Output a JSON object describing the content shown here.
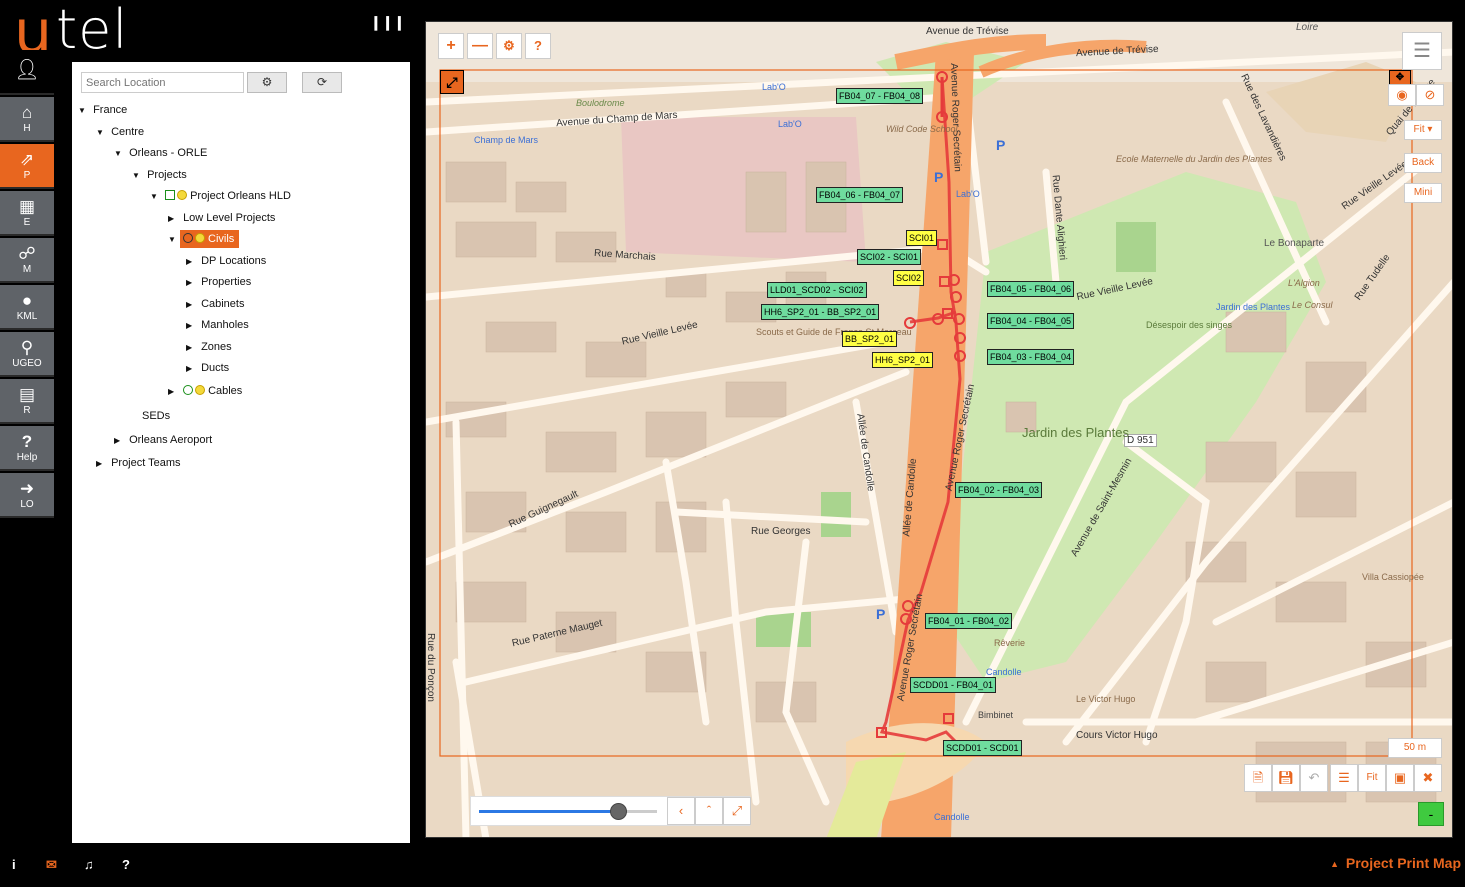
{
  "brand": {
    "logo_u": "u",
    "logo_tel": "tel"
  },
  "header": {
    "collapse_icon": "columns-icon"
  },
  "nav": {
    "items": [
      {
        "label": "",
        "icon": "user-icon"
      },
      {
        "label": "H",
        "icon": "home-icon"
      },
      {
        "label": "P",
        "icon": "share-icon"
      },
      {
        "label": "E",
        "icon": "chip-icon"
      },
      {
        "label": "M",
        "icon": "globe-icon"
      },
      {
        "label": "KML",
        "icon": "pin-icon"
      },
      {
        "label": "UGEO",
        "icon": "pin-icon"
      },
      {
        "label": "R",
        "icon": "card-icon"
      },
      {
        "label": "Help",
        "icon": "question-icon"
      },
      {
        "label": "LO",
        "icon": "logout-icon"
      }
    ]
  },
  "search": {
    "placeholder": "Search Location"
  },
  "tree": {
    "france": "France",
    "centre": "Centre",
    "orleans": "Orleans - ORLE",
    "projects": "Projects",
    "project_hld": "Project Orleans HLD",
    "low_level": "Low Level Projects",
    "civils": "Civils",
    "dp_locations": "DP Locations",
    "properties": "Properties",
    "cabinets": "Cabinets",
    "manholes": "Manholes",
    "zones": "Zones",
    "ducts": "Ducts",
    "cables": "Cables",
    "seds": "SEDs",
    "aeroport": "Orleans Aeroport",
    "teams": "Project Teams"
  },
  "map": {
    "streets": {
      "treviseA": "Avenue de Trévise",
      "treviseB": "Avenue de Trévise",
      "loire": "Loire",
      "champ": "Avenue du Champ de Mars",
      "boulodrome": "Boulodrome",
      "marchais": "Rue Marchais",
      "vieille1": "Rue Vieille Levée",
      "vieille2": "Rue Vieille Levée",
      "vieille3": "Rue Vieille Levée",
      "guignegault": "Rue Guignegault",
      "paterne": "Rue Paterne Mauget",
      "georges": "Rue Georges",
      "secretain": "Avenue Roger Secrétain",
      "secretain2": "Avenue Roger Secrétain",
      "secretain3": "Avenue Roger Secrétain",
      "candolle": "Allée de Candolle",
      "candolle2": "Allée de Candolle",
      "victorhugo": "Cours Victor Hugo",
      "dante": "Rue Dante Alighieri",
      "lavandieres": "Rue des Lavandières",
      "tudelle": "Rue Tudelle",
      "saintmesmin": "Avenue de Saint-Mesmin",
      "poncon": "Rue du Ponçon",
      "quai": "Quai de Prague",
      "d951": "D 951"
    },
    "places": {
      "jardin": "Jardin des Plantes",
      "bonaparte": "Le Bonaparte",
      "scouts": "Scouts et Guide de France St Marceau",
      "ecole": "Ecole Maternelle du Jardin des Plantes",
      "wildcode": "Wild Code School",
      "labo1": "Lab'O",
      "labo2": "Lab'O",
      "labo3": "Lab'O",
      "champmars": "Champ de Mars",
      "villa": "Villa Cassiopée",
      "victorhugo": "Le Victor Hugo",
      "bimbinet": "Bimbinet",
      "reverie": "Rêverie",
      "lalgion": "L'Algion",
      "leconsul": "Le Consul",
      "desespoir": "Désespoir des singes",
      "jardinplantes2": "Jardin des Plantes",
      "candolle": "Candolle",
      "candolle2": "Candolle"
    },
    "labels": {
      "l1": "FB04_07 - FB04_08",
      "l2": "FB04_06 - FB04_07",
      "l3": "SCI01",
      "l4": "SCI02 - SCI01",
      "l5": "SCI02",
      "l6": "LLD01_SCD02 - SCI02",
      "l7": "HH6_SP2_01 - BB_SP2_01",
      "l8": "BB_SP2_01",
      "l9": "HH6_SP2_01",
      "l10": "FB04_05 - FB04_06",
      "l11": "FB04_04 - FB04_05",
      "l12": "FB04_03 - FB04_04",
      "l13": "FB04_02 - FB04_03",
      "l14": "FB04_01 - FB04_02",
      "l15": "SCDD01 - FB04_01",
      "l16": "SCDD01 - SCD01"
    },
    "controls": {
      "fit": "Fit ▾",
      "back": "Back",
      "mini": "Mini",
      "scale": "50 m",
      "fit2": "Fit",
      "minus": "-"
    },
    "slider_value": 0.78
  },
  "footer": {
    "title": "Project Print Map",
    "caret": "▲"
  },
  "colors": {
    "accent": "#e8661f",
    "label_green": "#6fdc9e",
    "label_yellow": "#ffff44",
    "road_orange": "#f6a56a"
  }
}
